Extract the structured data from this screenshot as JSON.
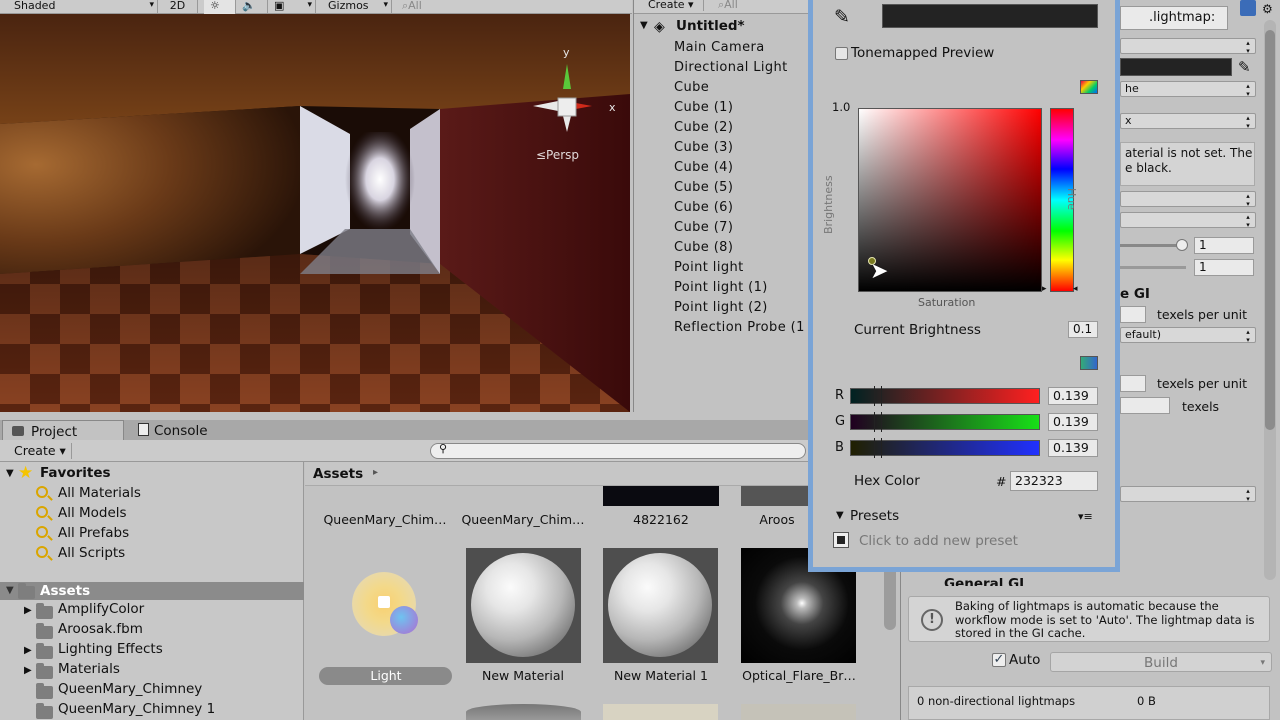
{
  "scene": {
    "shading_mode": "Shaded",
    "mode_2d": "2D",
    "gizmos": "Gizmos",
    "search_placeholder": "⌕All",
    "persp_label": "≤Persp",
    "axis_y": "y",
    "axis_x": "x"
  },
  "hierarchy": {
    "create": "Create",
    "search_placeholder": "⌕All",
    "scene_name": "Untitled*",
    "items": [
      "Main Camera",
      "Directional Light",
      "Cube",
      "Cube (1)",
      "Cube (2)",
      "Cube (3)",
      "Cube (4)",
      "Cube (5)",
      "Cube (6)",
      "Cube (7)",
      "Cube (8)",
      "Point light",
      "Point light (1)",
      "Point light (2)",
      "Reflection Probe (1"
    ]
  },
  "project": {
    "tab_project": "Project",
    "tab_console": "Console",
    "create": "Create",
    "favorites_label": "Favorites",
    "favorites": [
      "All Materials",
      "All Models",
      "All Prefabs",
      "All Scripts"
    ],
    "assets_label": "Assets",
    "folders": [
      "AmplifyColor",
      "Aroosak.fbm",
      "Lighting Effects",
      "Materials",
      "QueenMary_Chimney",
      "QueenMary_Chimney 1"
    ],
    "breadcrumb": "Assets",
    "row1": [
      "QueenMary_Chim…",
      "QueenMary_Chim…",
      "4822162",
      "Aroos"
    ],
    "row2": [
      "Light",
      "New Material",
      "New Material 1",
      "Optical_Flare_Br…"
    ]
  },
  "color_picker": {
    "tonemapped_preview": "Tonemapped Preview",
    "max_brightness": "1.0",
    "brightness_axis": "Brightness",
    "hue_axis": "Hue",
    "saturation_axis": "Saturation",
    "current_brightness_label": "Current Brightness",
    "current_brightness": "0.1",
    "r_label": "R",
    "r_value": "0.139",
    "g_label": "G",
    "g_value": "0.139",
    "b_label": "B",
    "b_value": "0.139",
    "hex_label": "Hex Color",
    "hex_hash": "#",
    "hex_value": "232323",
    "presets_label": "Presets",
    "add_preset": "Click to add new preset",
    "current_color": "#232323"
  },
  "inspector": {
    "lightmap_tab": ".lightmap:",
    "dd_me": "he",
    "dd_x": "x",
    "warning_line1": "aterial is not set. The",
    "warning_line2": "e black.",
    "slider1_value": "1",
    "slider2_value": "1",
    "gi_header": "e GI",
    "texels_per_unit_1": "texels per unit",
    "default_dd": "efault)",
    "texels_per_unit_2": "texels per unit",
    "texels": "texels",
    "gi_info": "Baking of lightmaps is automatic because the workflow mode is set to 'Auto'. The lightmap data is stored in the GI cache.",
    "auto_label": "Auto",
    "build_label": "Build",
    "lightmaps_info": "0 non-directional lightmaps",
    "lightmaps_size": "0 B",
    "general_gi_partial": "General GI"
  }
}
